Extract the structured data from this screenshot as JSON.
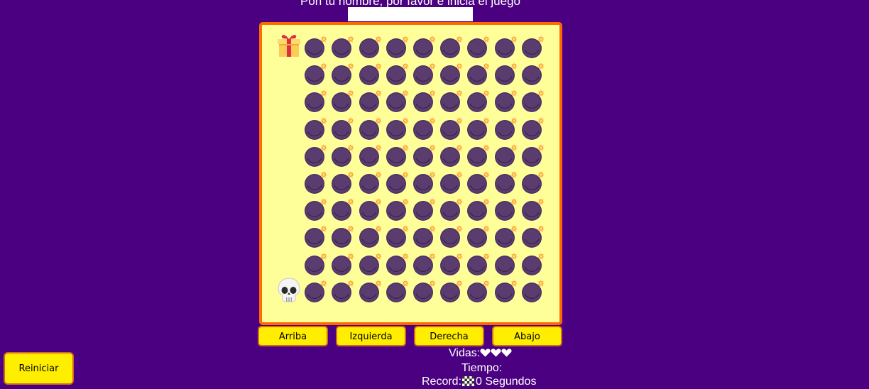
{
  "prompt": {
    "text": "Pon tu nombre, por favor e inicia el juego"
  },
  "name_input": {
    "value": "",
    "placeholder": ""
  },
  "board": {
    "rows": 10,
    "cols": 10,
    "start_cell": {
      "row": 0,
      "col": 0,
      "icon": "gift-icon"
    },
    "end_cell": {
      "row": 9,
      "col": 0,
      "icon": "skull-icon"
    },
    "other_cells_icon": "bomb-icon",
    "background_color": "#ffff99",
    "border_color": "#ff6a00"
  },
  "controls": {
    "up": "Arriba",
    "left": "Izquierda",
    "right": "Derecha",
    "down": "Abajo",
    "reset": "Reiniciar"
  },
  "stats": {
    "lives_label": "Vidas:",
    "lives_count": 3,
    "lives_icon": "heart-icon",
    "time_label": "Tiempo:",
    "time_value": "",
    "record_label": "Record:",
    "record_icon": "checkered-flag-icon",
    "record_value": "0 Segundos"
  },
  "colors": {
    "background": "#4b0082",
    "button": "#ffee00",
    "button_border": "#d2691e",
    "bomb": "#5a3d6e",
    "fuse_spark": "#ff8c1a"
  }
}
